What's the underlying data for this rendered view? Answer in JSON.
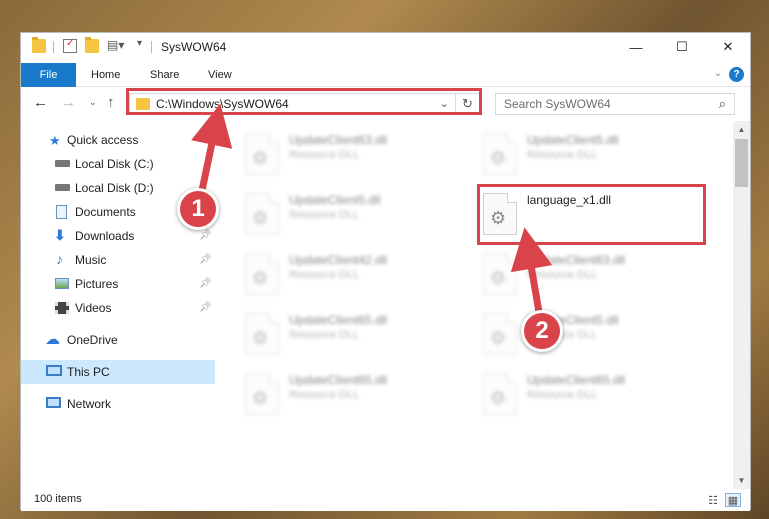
{
  "window": {
    "title": "SysWOW64",
    "controls": {
      "minimize": "—",
      "maximize": "☐",
      "close": "✕"
    }
  },
  "ribbon": {
    "tabs": [
      "File",
      "Home",
      "Share",
      "View"
    ],
    "help": "?"
  },
  "address_bar": {
    "path": "C:\\Windows\\SysWOW64",
    "refresh": "↻",
    "dropdown": "⌄"
  },
  "search": {
    "placeholder": "Search SysWOW64",
    "icon": "⌕"
  },
  "sidebar": {
    "items": [
      {
        "label": "Quick access",
        "icon": "star-icon",
        "pinned": false
      },
      {
        "label": "Local Disk (C:)",
        "icon": "drive-icon",
        "pinned": false
      },
      {
        "label": "Local Disk (D:)",
        "icon": "drive-icon",
        "pinned": false
      },
      {
        "label": "Documents",
        "icon": "documents-icon",
        "pinned": true
      },
      {
        "label": "Downloads",
        "icon": "download-icon",
        "pinned": true
      },
      {
        "label": "Music",
        "icon": "music-icon",
        "pinned": true
      },
      {
        "label": "Pictures",
        "icon": "pictures-icon",
        "pinned": true
      },
      {
        "label": "Videos",
        "icon": "videos-icon",
        "pinned": true
      },
      {
        "label": "OneDrive",
        "icon": "cloud-icon",
        "pinned": false
      },
      {
        "label": "This PC",
        "icon": "computer-icon",
        "pinned": false,
        "selected": true
      },
      {
        "label": "Network",
        "icon": "network-icon",
        "pinned": false
      }
    ]
  },
  "files": [
    {
      "name": "UpdateClient63.dll",
      "type": "Resource DLL"
    },
    {
      "name": "UpdateClient5.dll",
      "type": "Resource DLL"
    },
    {
      "name": "UpdateClient5.dll",
      "type": "Resource DLL"
    },
    {
      "name": "language_x1.dll",
      "type": ""
    },
    {
      "name": "UpdateClient42.dll",
      "type": "Resource DLL"
    },
    {
      "name": "UpdateClient63.dll",
      "type": "Resource DLL"
    },
    {
      "name": "UpdateClient65.dll",
      "type": "Resource DLL"
    },
    {
      "name": "UpdateClient5.dll",
      "type": "Resource DLL"
    },
    {
      "name": "UpdateClient65.dll",
      "type": "Resource DLL"
    },
    {
      "name": "UpdateClient65.dll",
      "type": "Resource DLL"
    }
  ],
  "status_bar": {
    "item_count": "100 items"
  },
  "annotations": {
    "step1": "1",
    "step2": "2",
    "color": "#d9444a"
  }
}
